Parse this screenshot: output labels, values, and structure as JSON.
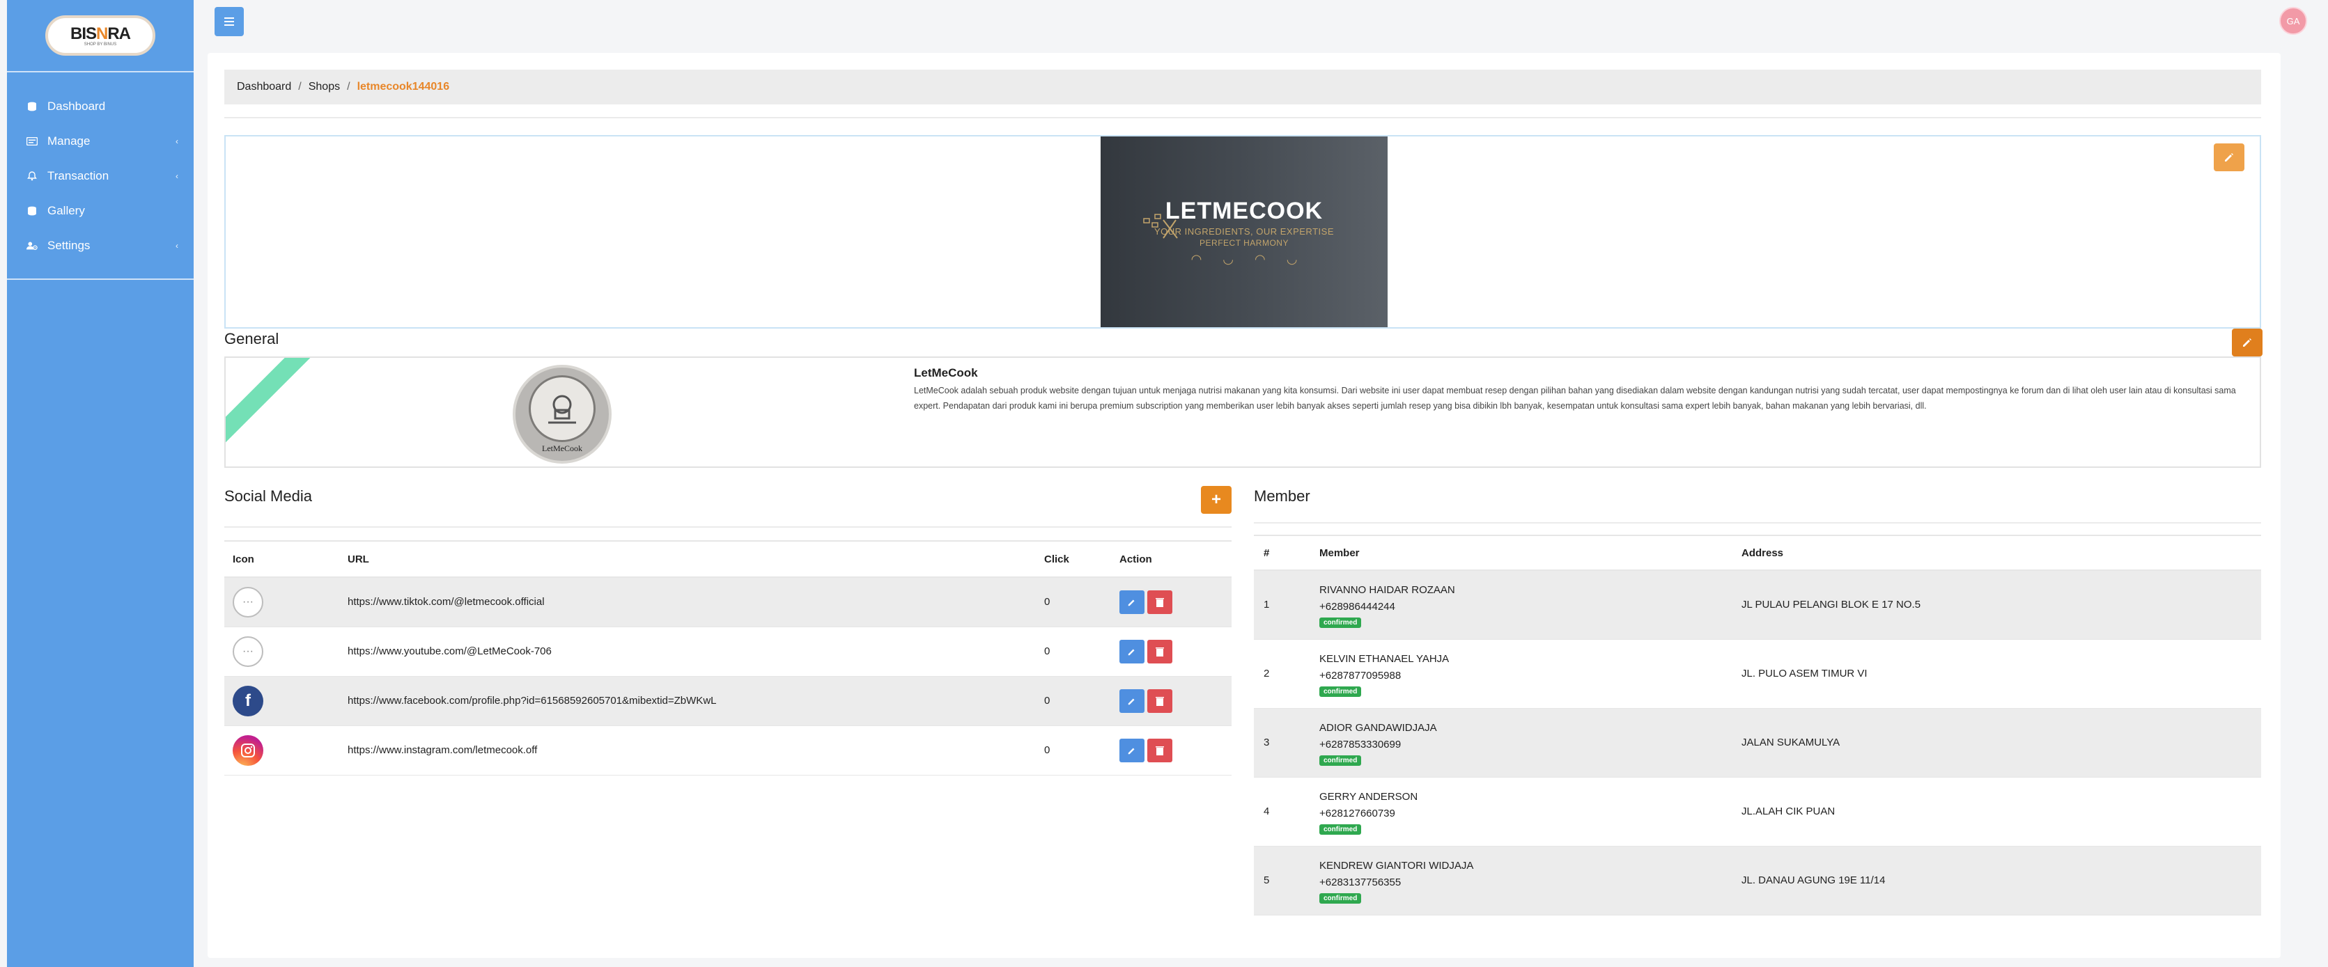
{
  "brand": {
    "name_pre": "BIS",
    "name_o": "N",
    "name_post": "RA",
    "tagline": "SHOP BY BINUS"
  },
  "sidebar": {
    "items": [
      {
        "label": "Dashboard",
        "icon": "dashboard-icon",
        "has_chevron": false
      },
      {
        "label": "Manage",
        "icon": "manage-icon",
        "has_chevron": true
      },
      {
        "label": "Transaction",
        "icon": "transaction-icon",
        "has_chevron": true
      },
      {
        "label": "Gallery",
        "icon": "gallery-icon",
        "has_chevron": false
      },
      {
        "label": "Settings",
        "icon": "settings-icon",
        "has_chevron": true
      }
    ]
  },
  "topbar": {
    "menu_icon": "hamburger-icon",
    "avatar_initials": "GA"
  },
  "breadcrumb": {
    "items": [
      "Dashboard",
      "Shops"
    ],
    "active": "letmecook144016"
  },
  "banner": {
    "title": "LETMECOOK",
    "subtitle": "YOUR INGREDIENTS, OUR EXPERTISE",
    "subtitle2": "PERFECT HARMONY"
  },
  "general": {
    "heading": "General",
    "logo_label": "LetMeCook",
    "shop_name": "LetMeCook",
    "description": "LetMeCook adalah sebuah produk website dengan tujuan untuk menjaga nutrisi makanan yang kita konsumsi. Dari website ini user dapat membuat resep dengan pilihan bahan yang disediakan dalam website dengan kandungan nutrisi yang sudah tercatat, user dapat mempostingnya ke forum dan di lihat oleh user lain atau di konsultasi sama expert. Pendapatan dari produk kami ini berupa premium subscription yang memberikan user lebih banyak akses seperti jumlah resep yang bisa dibikin lbh banyak, kesempatan untuk konsultasi sama expert lebih banyak, bahan makanan yang lebih bervariasi, dll."
  },
  "social_media": {
    "heading": "Social Media",
    "add_label": "+",
    "columns": {
      "icon": "Icon",
      "url": "URL",
      "click": "Click",
      "action": "Action"
    },
    "rows": [
      {
        "icon": "more-icon",
        "url": "https://www.tiktok.com/@letmecook.official",
        "click": "0"
      },
      {
        "icon": "more-icon",
        "url": "https://www.youtube.com/@LetMeCook-706",
        "click": "0"
      },
      {
        "icon": "facebook-icon",
        "url": "https://www.facebook.com/profile.php?id=61568592605701&mibextid=ZbWKwL",
        "click": "0"
      },
      {
        "icon": "instagram-icon",
        "url": "https://www.instagram.com/letmecook.off",
        "click": "0"
      }
    ]
  },
  "members": {
    "heading": "Member",
    "columns": {
      "num": "#",
      "member": "Member",
      "address": "Address"
    },
    "rows": [
      {
        "num": "1",
        "name": "RIVANNO HAIDAR ROZAAN",
        "phone": "+628986444244",
        "status": "confirmed",
        "address": "JL PULAU PELANGI BLOK E 17 NO.5"
      },
      {
        "num": "2",
        "name": "KELVIN ETHANAEL YAHJA",
        "phone": "+6287877095988",
        "status": "confirmed",
        "address": "JL. PULO ASEM TIMUR VI"
      },
      {
        "num": "3",
        "name": "ADIOR GANDAWIDJAJA",
        "phone": "+6287853330699",
        "status": "confirmed",
        "address": "JALAN SUKAMULYA"
      },
      {
        "num": "4",
        "name": "GERRY ANDERSON",
        "phone": "+628127660739",
        "status": "confirmed",
        "address": "JL.ALAH CIK PUAN"
      },
      {
        "num": "5",
        "name": "KENDREW GIANTORI WIDJAJA",
        "phone": "+6283137756355",
        "status": "confirmed",
        "address": "JL. DANAU AGUNG 19E 11/14"
      }
    ]
  },
  "colors": {
    "sidebar": "#5b9ee6",
    "accent": "#e8872a",
    "edit": "#4f8fe0",
    "delete": "#df4e53",
    "confirmed": "#2fa84f"
  }
}
